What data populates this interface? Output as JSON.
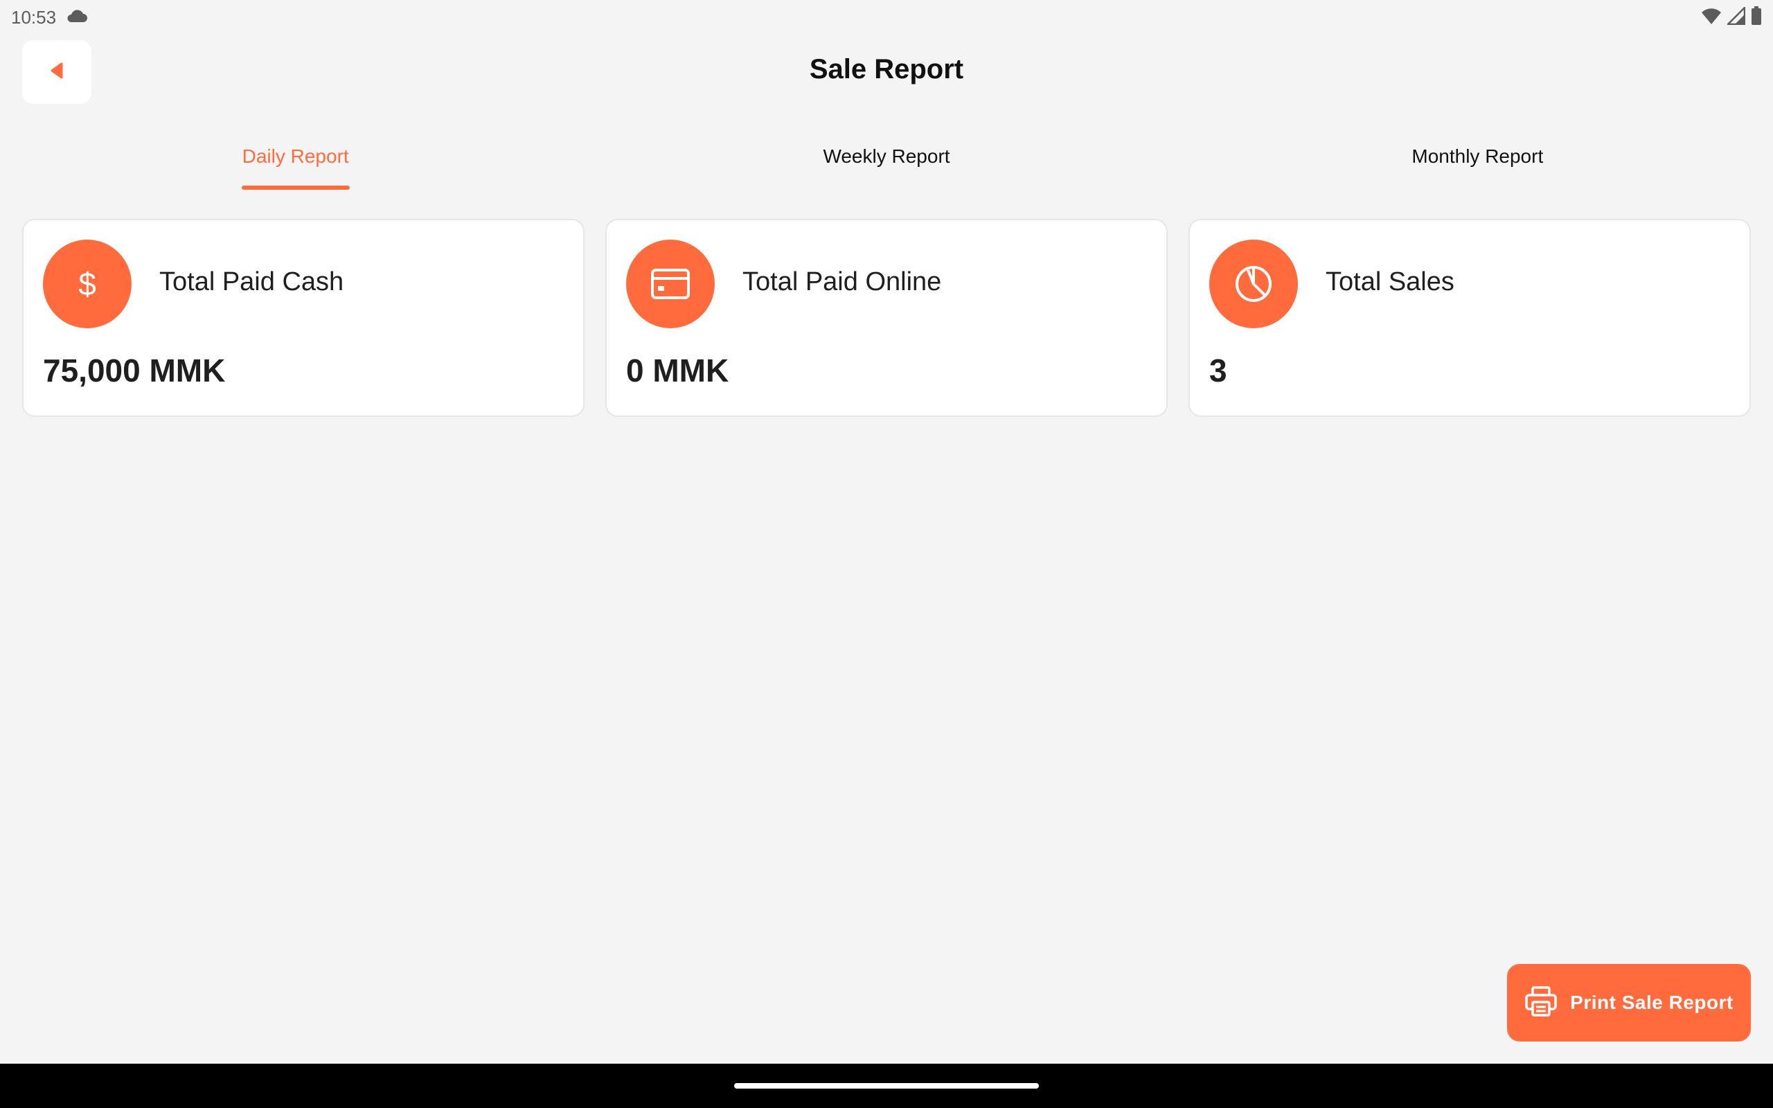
{
  "status_bar": {
    "time": "10:53",
    "icons": [
      "cloud-icon",
      "wifi-icon",
      "signal-icon",
      "battery-icon"
    ]
  },
  "header": {
    "back_icon": "back-arrow-icon",
    "title": "Sale Report"
  },
  "tabs": [
    {
      "label": "Daily Report",
      "active": true
    },
    {
      "label": "Weekly Report",
      "active": false
    },
    {
      "label": "Monthly Report",
      "active": false
    }
  ],
  "cards": [
    {
      "icon": "dollar-icon",
      "label": "Total Paid Cash",
      "value": "75,000 MMK"
    },
    {
      "icon": "credit-card-icon",
      "label": "Total Paid Online",
      "value": "0 MMK"
    },
    {
      "icon": "pie-chart-icon",
      "label": "Total Sales",
      "value": "3"
    }
  ],
  "print_button": {
    "icon": "printer-icon",
    "label": "Print Sale Report"
  },
  "colors": {
    "accent": "#ff6b3d",
    "background": "#f4f4f4",
    "card": "#ffffff",
    "text": "#1c1c1c"
  }
}
